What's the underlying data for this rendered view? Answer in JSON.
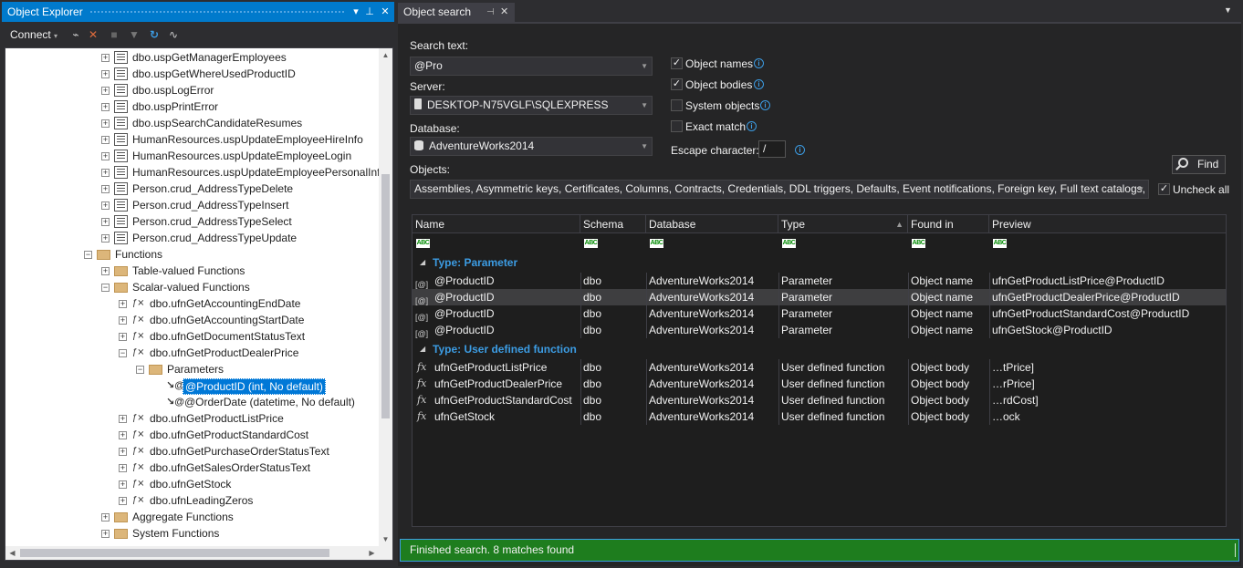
{
  "object_explorer": {
    "title": "Object Explorer",
    "title_buttons": [
      "▼",
      "📌",
      "✕"
    ],
    "toolbar": {
      "connect_label": "Connect",
      "icons": [
        "connect-icon",
        "disconnect-icon",
        "stop-icon",
        "filter-icon",
        "refresh-icon",
        "activity-monitor-icon"
      ]
    },
    "tree": [
      {
        "label": "dbo.uspGetManagerEmployees",
        "level": 4,
        "icon": "proc",
        "exp": "+"
      },
      {
        "label": "dbo.uspGetWhereUsedProductID",
        "level": 4,
        "icon": "proc",
        "exp": "+"
      },
      {
        "label": "dbo.uspLogError",
        "level": 4,
        "icon": "proc",
        "exp": "+"
      },
      {
        "label": "dbo.uspPrintError",
        "level": 4,
        "icon": "proc",
        "exp": "+"
      },
      {
        "label": "dbo.uspSearchCandidateResumes",
        "level": 4,
        "icon": "proc",
        "exp": "+"
      },
      {
        "label": "HumanResources.uspUpdateEmployeeHireInfo",
        "level": 4,
        "icon": "proc",
        "exp": "+"
      },
      {
        "label": "HumanResources.uspUpdateEmployeeLogin",
        "level": 4,
        "icon": "proc",
        "exp": "+"
      },
      {
        "label": "HumanResources.uspUpdateEmployeePersonalInfo",
        "level": 4,
        "icon": "proc",
        "exp": "+"
      },
      {
        "label": "Person.crud_AddressTypeDelete",
        "level": 4,
        "icon": "proc",
        "exp": "+"
      },
      {
        "label": "Person.crud_AddressTypeInsert",
        "level": 4,
        "icon": "proc",
        "exp": "+"
      },
      {
        "label": "Person.crud_AddressTypeSelect",
        "level": 4,
        "icon": "proc",
        "exp": "+"
      },
      {
        "label": "Person.crud_AddressTypeUpdate",
        "level": 4,
        "icon": "proc",
        "exp": "+"
      },
      {
        "label": "Functions",
        "level": 3,
        "icon": "folder",
        "exp": "−"
      },
      {
        "label": "Table-valued Functions",
        "level": 4,
        "icon": "folder",
        "exp": "+"
      },
      {
        "label": "Scalar-valued Functions",
        "level": 4,
        "icon": "folder",
        "exp": "−"
      },
      {
        "label": "dbo.ufnGetAccountingEndDate",
        "level": 5,
        "icon": "func",
        "exp": "+"
      },
      {
        "label": "dbo.ufnGetAccountingStartDate",
        "level": 5,
        "icon": "func",
        "exp": "+"
      },
      {
        "label": "dbo.ufnGetDocumentStatusText",
        "level": 5,
        "icon": "func",
        "exp": "+"
      },
      {
        "label": "dbo.ufnGetProductDealerPrice",
        "level": 5,
        "icon": "func",
        "exp": "−"
      },
      {
        "label": "Parameters",
        "level": 6,
        "icon": "folder",
        "exp": "−"
      },
      {
        "label": "@ProductID (int, No default)",
        "level": 7,
        "icon": "param",
        "exp": "",
        "selected": true
      },
      {
        "label": "@OrderDate (datetime, No default)",
        "level": 7,
        "icon": "param",
        "exp": ""
      },
      {
        "label": "dbo.ufnGetProductListPrice",
        "level": 5,
        "icon": "func",
        "exp": "+"
      },
      {
        "label": "dbo.ufnGetProductStandardCost",
        "level": 5,
        "icon": "func",
        "exp": "+"
      },
      {
        "label": "dbo.ufnGetPurchaseOrderStatusText",
        "level": 5,
        "icon": "func",
        "exp": "+"
      },
      {
        "label": "dbo.ufnGetSalesOrderStatusText",
        "level": 5,
        "icon": "func",
        "exp": "+"
      },
      {
        "label": "dbo.ufnGetStock",
        "level": 5,
        "icon": "func",
        "exp": "+"
      },
      {
        "label": "dbo.ufnLeadingZeros",
        "level": 5,
        "icon": "func",
        "exp": "+"
      },
      {
        "label": "Aggregate Functions",
        "level": 4,
        "icon": "folder",
        "exp": "+"
      },
      {
        "label": "System Functions",
        "level": 4,
        "icon": "folder",
        "exp": "+"
      }
    ]
  },
  "object_search": {
    "tab_label": "Object search",
    "search_text_label": "Search text:",
    "search_text_value": "@Pro",
    "server_label": "Server:",
    "server_value": "DESKTOP-N75VGLF\\SQLEXPRESS",
    "database_label": "Database:",
    "database_value": "AdventureWorks2014",
    "objects_label": "Objects:",
    "objects_value": "Assemblies, Asymmetric keys, Certificates, Columns, Contracts, Credentials, DDL triggers, Defaults, Event notifications, Foreign key, Full text catalogs, Full text ...",
    "options": [
      {
        "label": "Object names",
        "checked": true
      },
      {
        "label": "Object bodies",
        "checked": true
      },
      {
        "label": "System objects",
        "checked": false
      },
      {
        "label": "Exact match",
        "checked": false
      }
    ],
    "escape_label": "Escape character:",
    "escape_value": "/",
    "find_label": "Find",
    "uncheck_all_label": "Uncheck all",
    "uncheck_all_checked": true,
    "columns": [
      "Name",
      "Schema",
      "Database",
      "Type",
      "Found in",
      "Preview"
    ],
    "sort_column": "Type",
    "groups": [
      {
        "title": "Type: Parameter",
        "rows": [
          {
            "name": "@ProductID",
            "schema": "dbo",
            "database": "AdventureWorks2014",
            "type": "Parameter",
            "found_in": "Object name",
            "preview": "ufnGetProductListPrice@ProductID",
            "icon": "[@]"
          },
          {
            "name": "@ProductID",
            "schema": "dbo",
            "database": "AdventureWorks2014",
            "type": "Parameter",
            "found_in": "Object name",
            "preview": "ufnGetProductDealerPrice@ProductID",
            "icon": "[@]",
            "highlighted": true
          },
          {
            "name": "@ProductID",
            "schema": "dbo",
            "database": "AdventureWorks2014",
            "type": "Parameter",
            "found_in": "Object name",
            "preview": "ufnGetProductStandardCost@ProductID",
            "icon": "[@]"
          },
          {
            "name": "@ProductID",
            "schema": "dbo",
            "database": "AdventureWorks2014",
            "type": "Parameter",
            "found_in": "Object name",
            "preview": "ufnGetStock@ProductID",
            "icon": "[@]"
          }
        ]
      },
      {
        "title": "Type: User defined function",
        "rows": [
          {
            "name": "ufnGetProductListPrice",
            "schema": "dbo",
            "database": "AdventureWorks2014",
            "type": "User defined function",
            "found_in": "Object body",
            "preview": "…tPrice]",
            "icon": "fx"
          },
          {
            "name": "ufnGetProductDealerPrice",
            "schema": "dbo",
            "database": "AdventureWorks2014",
            "type": "User defined function",
            "found_in": "Object body",
            "preview": "…rPrice]",
            "icon": "fx"
          },
          {
            "name": "ufnGetProductStandardCost",
            "schema": "dbo",
            "database": "AdventureWorks2014",
            "type": "User defined function",
            "found_in": "Object body",
            "preview": "…rdCost]",
            "icon": "fx"
          },
          {
            "name": "ufnGetStock",
            "schema": "dbo",
            "database": "AdventureWorks2014",
            "type": "User defined function",
            "found_in": "Object body",
            "preview": "…ock",
            "icon": "fx"
          }
        ]
      }
    ],
    "status": "Finished search. 8 matches found"
  },
  "colors": {
    "accent": "#007acc",
    "status_green": "#1e7d1e",
    "group_header": "#3c9ce3",
    "selection": "#0078d7"
  }
}
